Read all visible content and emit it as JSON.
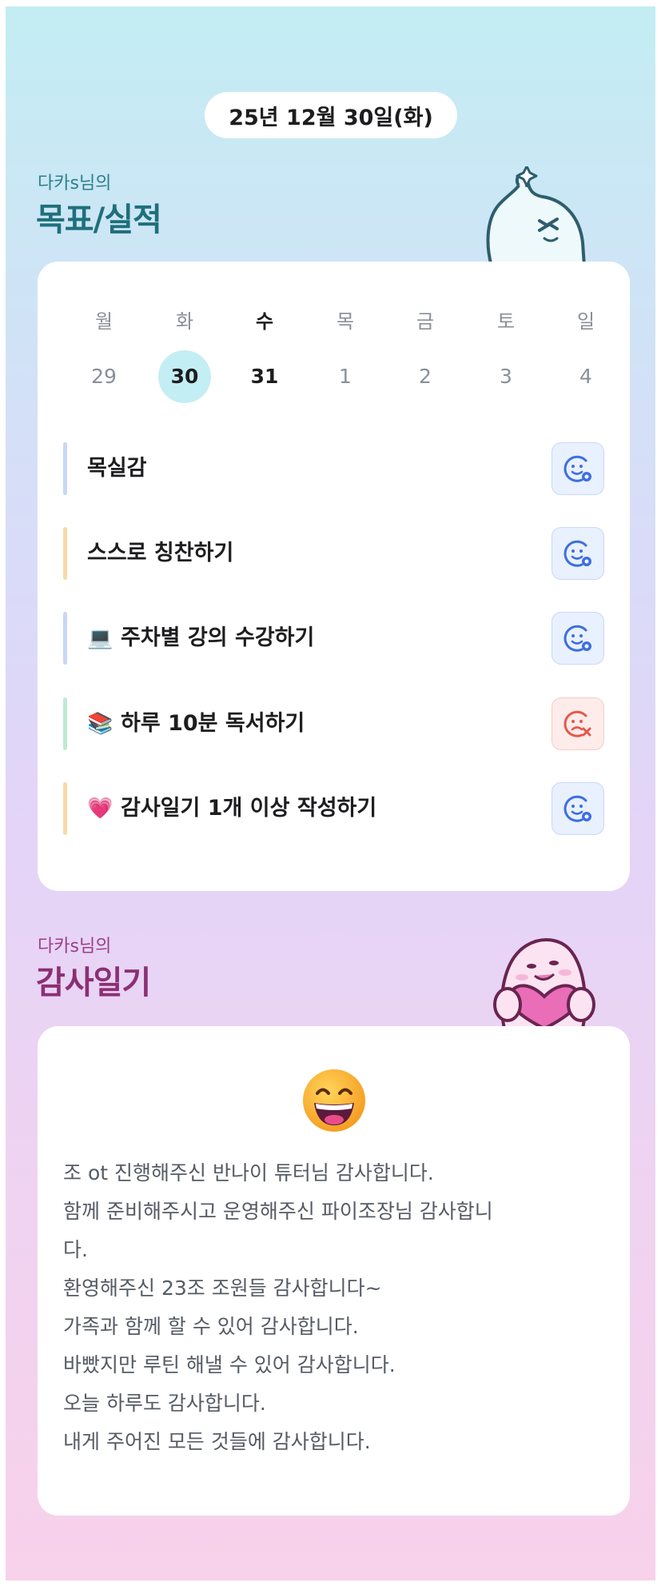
{
  "date": "25년 12월 30일(화)",
  "goals_section": {
    "subtitle": "다카s님의",
    "title": "목표/실적"
  },
  "week": [
    {
      "day": "월",
      "num": "29"
    },
    {
      "day": "화",
      "num": "30"
    },
    {
      "day": "수",
      "num": "31"
    },
    {
      "day": "목",
      "num": "1"
    },
    {
      "day": "금",
      "num": "2"
    },
    {
      "day": "토",
      "num": "3"
    },
    {
      "day": "일",
      "num": "4"
    }
  ],
  "selected_day": "30",
  "goals": [
    {
      "label": "목실감",
      "emoji": "",
      "status": "done",
      "bar_color": "#c9d6f6"
    },
    {
      "label": "스스로 칭찬하기",
      "emoji": "",
      "status": "done",
      "bar_color": "#f8d9a8"
    },
    {
      "label": "주차별 강의 수강하기",
      "emoji": "💻",
      "status": "done",
      "bar_color": "#c9d6f6"
    },
    {
      "label": "하루 10분 독서하기",
      "emoji": "📚",
      "status": "fail",
      "bar_color": "#bfe9d5"
    },
    {
      "label": "감사일기 1개 이상 작성하기",
      "emoji": "💗",
      "status": "done",
      "bar_color": "#f8d9a8"
    }
  ],
  "gratitude_section": {
    "subtitle": "다카s님의",
    "title": "감사일기"
  },
  "gratitude": {
    "emoji": "grinning-face-icon",
    "lines": [
      "조 ot 진행해주신 반나이 튜터님 감사합니다.",
      "함께 준비해주시고 운영해주신 파이조장님 감사합니",
      "다.",
      "환영해주신 23조 조원들 감사합니다~",
      "가족과 함께 할 수 있어 감사합니다.",
      "바빴지만 루틴 해낼 수 있어 감사합니다.",
      "오늘 하루도 감사합니다.",
      "내게 주어진 모든 것들에 감사합니다."
    ]
  },
  "colors": {
    "ok": "#3b6fe0",
    "fail": "#e5584a",
    "goal_title": "#1f6f7c",
    "gratitude_title": "#8c2f74"
  }
}
